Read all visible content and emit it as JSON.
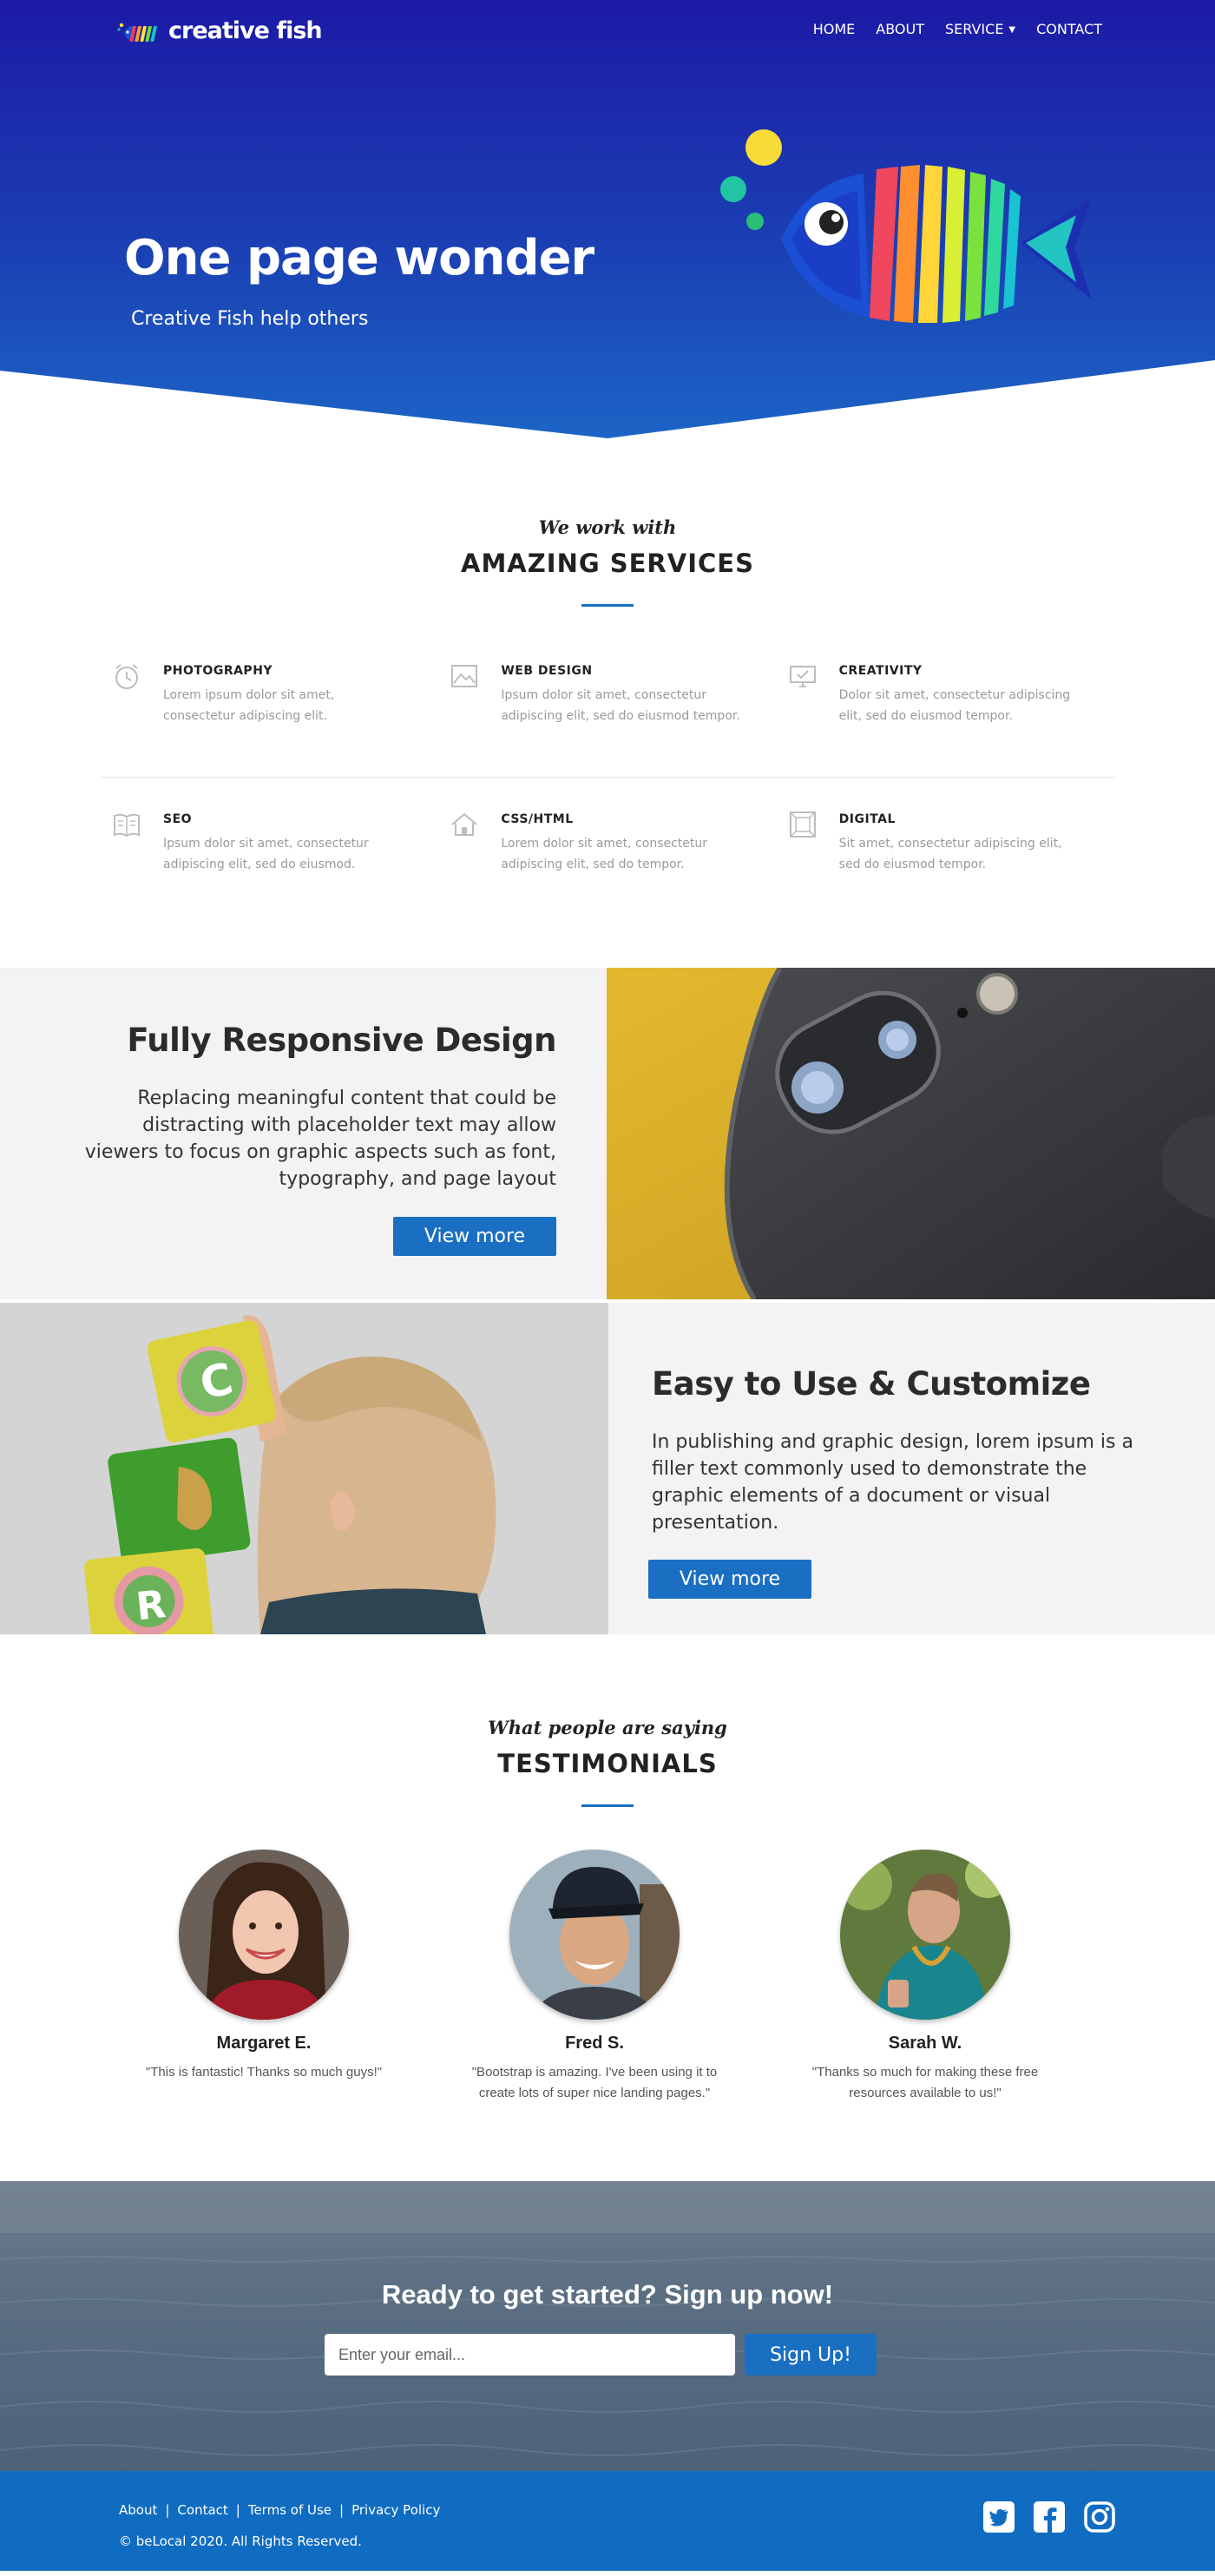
{
  "brand": {
    "name": "creative fish"
  },
  "nav": {
    "items": [
      {
        "label": "HOME"
      },
      {
        "label": "ABOUT"
      },
      {
        "label": "SERVICE"
      },
      {
        "label": "CONTACT"
      }
    ]
  },
  "hero": {
    "title": "One page wonder",
    "subtitle": "Creative Fish help others"
  },
  "services": {
    "kicker": "We work with",
    "title": "AMAZING SERVICES",
    "items": [
      {
        "icon": "alarm-clock-icon",
        "title": "PHOTOGRAPHY",
        "text": "Lorem ipsum dolor sit amet, consectetur adipiscing elit."
      },
      {
        "icon": "image-icon",
        "title": "WEB DESIGN",
        "text": "Ipsum dolor sit amet, consectetur adipiscing elit, sed do eiusmod tempor."
      },
      {
        "icon": "monitor-icon",
        "title": "CREATIVITY",
        "text": "Dolor sit amet, consectetur adipiscing elit, sed do eiusmod tempor."
      },
      {
        "icon": "book-icon",
        "title": "SEO",
        "text": "Ipsum dolor sit amet, consectetur adipiscing elit, sed do eiusmod."
      },
      {
        "icon": "home-icon",
        "title": "CSS/HTML",
        "text": "Lorem dolor sit amet, consectetur adipiscing elit, sed do tempor."
      },
      {
        "icon": "frame-icon",
        "title": "DIGITAL",
        "text": "Sit amet, consectetur adipiscing elit, sed do eiusmod tempor."
      }
    ]
  },
  "features": [
    {
      "title": "Fully Responsive Design",
      "text": "Replacing meaningful content that could be distracting with placeholder text may allow viewers to focus on graphic aspects such as font, typography, and page layout",
      "button": "View more"
    },
    {
      "title": "Easy to Use & Customize",
      "text": "In publishing and graphic design, lorem ipsum is a filler text commonly used to demonstrate the graphic elements of a document or visual presentation.",
      "button": "View more"
    }
  ],
  "testimonials": {
    "kicker": "What people are saying",
    "title": "TESTIMONIALS",
    "items": [
      {
        "name": "Margaret E.",
        "quote": "\"This is fantastic! Thanks so much guys!\""
      },
      {
        "name": "Fred S.",
        "quote": "\"Bootstrap is amazing. I've been using it to create lots of super nice landing pages.\""
      },
      {
        "name": "Sarah W.",
        "quote": "\"Thanks so much for making these free resources available to us!\""
      }
    ]
  },
  "cta": {
    "title": "Ready to get started? Sign up now!",
    "placeholder": "Enter your email...",
    "button": "Sign Up!"
  },
  "footer": {
    "links": [
      {
        "label": "About"
      },
      {
        "label": "Contact"
      },
      {
        "label": "Terms of Use"
      },
      {
        "label": "Privacy Policy"
      }
    ],
    "separator": "|",
    "copyright": "© beLocal 2020. All Rights Reserved.",
    "social": [
      "twitter-icon",
      "facebook-icon",
      "instagram-icon"
    ]
  },
  "colors": {
    "accent": "#1b6fc2",
    "hero_top": "#1c1aa6",
    "hero_bottom": "#1c64c6",
    "footer": "#0f6cc1",
    "feature_bg": "#f3f3f3"
  }
}
